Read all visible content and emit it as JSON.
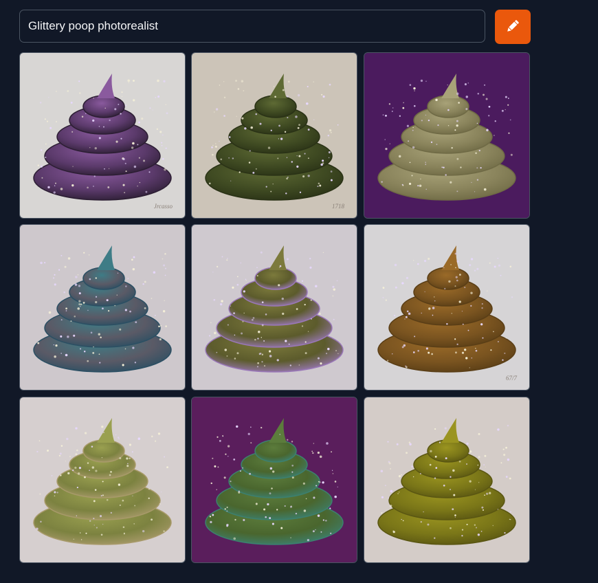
{
  "prompt": {
    "value": "Glittery poop photorealist"
  },
  "generate_button": {
    "icon": "pencil-icon",
    "color": "#ea580c"
  },
  "results": [
    {
      "background": "#d8d6d4",
      "palette": [
        "#8a5a9e",
        "#5b3a6b",
        "#2c1e33"
      ],
      "signature": "Jrcasso"
    },
    {
      "background": "#ccc4b8",
      "palette": [
        "#5e6a34",
        "#3f4a22",
        "#2a3216"
      ],
      "signature": "1718"
    },
    {
      "background": "#4b1b5e",
      "palette": [
        "#a8a278",
        "#8a845c",
        "#6f6a45"
      ],
      "signature": ""
    },
    {
      "background": "#cec8cc",
      "palette": [
        "#3e7c86",
        "#5a5a66",
        "#2b4f63"
      ],
      "signature": ""
    },
    {
      "background": "#cfc9cf",
      "palette": [
        "#7c7a3c",
        "#5c5b2c",
        "#9a78b8"
      ],
      "signature": ""
    },
    {
      "background": "#d6d4d6",
      "palette": [
        "#9a6a28",
        "#7a5420",
        "#5a3e16"
      ],
      "signature": "67/7"
    },
    {
      "background": "#d6cfcf",
      "palette": [
        "#9aa050",
        "#7c8240",
        "#a89a6a"
      ],
      "signature": ""
    },
    {
      "background": "#5a1e5c",
      "palette": [
        "#5c7c3c",
        "#4a662e",
        "#3c8070"
      ],
      "signature": ""
    },
    {
      "background": "#d4ccc8",
      "palette": [
        "#9a9420",
        "#7a7618",
        "#5a5612"
      ],
      "signature": ""
    }
  ]
}
